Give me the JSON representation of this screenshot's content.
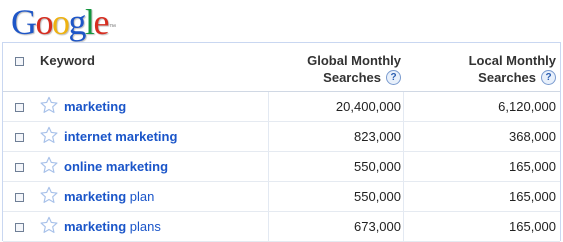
{
  "logo": {
    "text": "Google",
    "tm": "™",
    "letter_colors": [
      "#1e56c7",
      "#d62d20",
      "#eeb211",
      "#1e56c7",
      "#14963f",
      "#d62d20"
    ]
  },
  "table": {
    "headers": {
      "keyword": "Keyword",
      "global_line1": "Global Monthly",
      "global_line2": "Searches",
      "local_line1": "Local Monthly",
      "local_line2": "Searches",
      "help_icon": "?"
    },
    "rows": [
      {
        "kw_bold": "marketing",
        "kw_normal": "",
        "global": "20,400,000",
        "local": "6,120,000"
      },
      {
        "kw_bold": "internet marketing",
        "kw_normal": "",
        "global": "823,000",
        "local": "368,000"
      },
      {
        "kw_bold": "online marketing",
        "kw_normal": "",
        "global": "550,000",
        "local": "165,000"
      },
      {
        "kw_bold": "marketing",
        "kw_normal": " plan",
        "global": "550,000",
        "local": "165,000"
      },
      {
        "kw_bold": "marketing",
        "kw_normal": " plans",
        "global": "673,000",
        "local": "165,000"
      }
    ]
  },
  "icons": {
    "checkbox": "checkbox-icon",
    "star": "star-outline-icon",
    "help": "help-question-icon"
  },
  "colors": {
    "link": "#1a55c9",
    "star_stroke": "#a9c2ea",
    "border": "#c9d7f1"
  }
}
